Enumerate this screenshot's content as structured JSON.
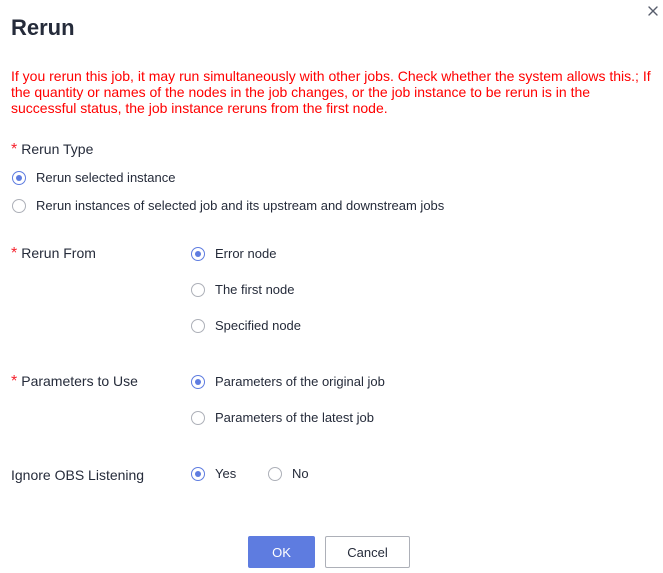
{
  "dialog": {
    "title": "Rerun",
    "warning": "If you rerun this job, it may run simultaneously with other jobs. Check whether the system allows this.; If the quantity or names of the nodes in the job changes, or the job instance to be rerun is in the successful status, the job instance reruns from the first node."
  },
  "rerun_type": {
    "required_mark": "*",
    "label": "Rerun Type",
    "options": [
      {
        "label": "Rerun selected instance",
        "checked": true
      },
      {
        "label": "Rerun instances of selected job and its upstream and downstream jobs",
        "checked": false
      }
    ]
  },
  "rerun_from": {
    "required_mark": "*",
    "label": "Rerun From",
    "options": [
      {
        "label": "Error node",
        "checked": true
      },
      {
        "label": "The first node",
        "checked": false
      },
      {
        "label": "Specified node",
        "checked": false
      }
    ]
  },
  "parameters": {
    "required_mark": "*",
    "label": "Parameters to Use",
    "options": [
      {
        "label": "Parameters of the original job",
        "checked": true
      },
      {
        "label": "Parameters of the latest job",
        "checked": false
      }
    ]
  },
  "ignore_obs": {
    "label": "Ignore OBS Listening",
    "options": [
      {
        "label": "Yes",
        "checked": true
      },
      {
        "label": "No",
        "checked": false
      }
    ]
  },
  "footer": {
    "ok_label": "OK",
    "cancel_label": "Cancel"
  },
  "colors": {
    "accent": "#5e7ce0",
    "warning": "#ff0000",
    "required": "#f5222d"
  },
  "icons": {
    "close": "close-icon"
  }
}
